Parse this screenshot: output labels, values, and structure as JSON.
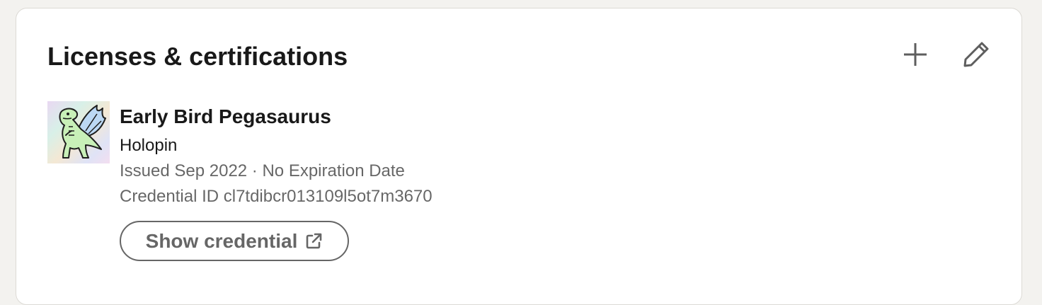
{
  "section": {
    "title": "Licenses & certifications",
    "actions": {
      "add_icon": "plus-icon",
      "edit_icon": "pencil-icon"
    }
  },
  "certification": {
    "logo_icon": "winged-dinosaur-badge",
    "name": "Early Bird Pegasaurus",
    "issuer": "Holopin",
    "issued": "Issued Sep 2022 · No Expiration Date",
    "credential_id": "Credential ID cl7tdibcr013109l5ot7m3670",
    "show_credential_label": "Show credential",
    "show_credential_icon": "external-link-icon"
  },
  "colors": {
    "background": "#f3f2ef",
    "card": "#ffffff",
    "secondary_text": "#666666",
    "badge_green": "#c8f0b8",
    "badge_wing": "#bcd8f4"
  }
}
